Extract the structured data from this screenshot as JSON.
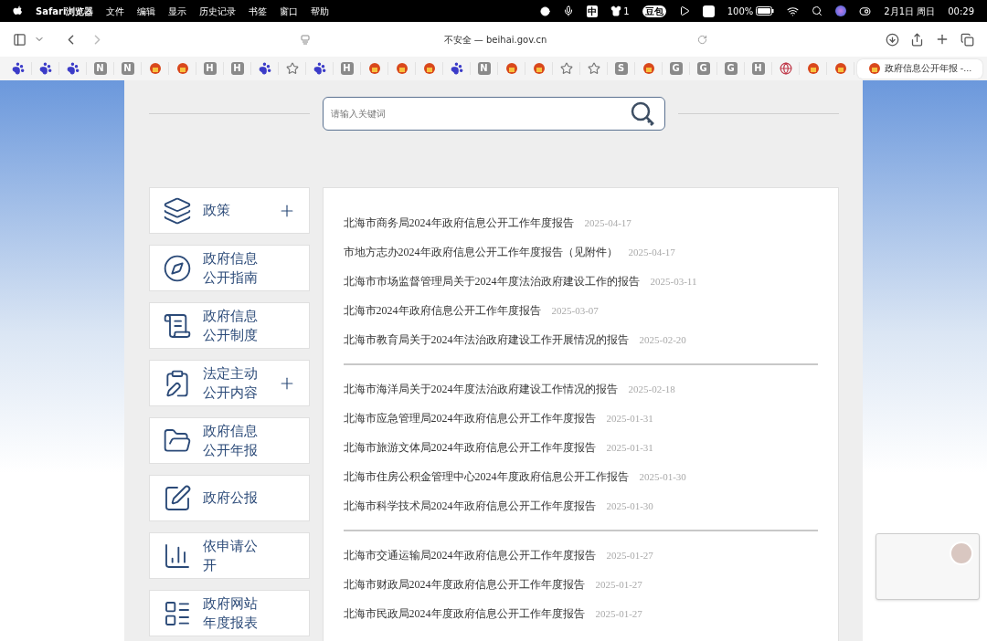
{
  "menu_bar": {
    "app_name": "Safari浏览器",
    "menus": [
      "文件",
      "编辑",
      "显示",
      "历史记录",
      "书签",
      "窗口",
      "帮助"
    ],
    "status": {
      "input_method": "中",
      "shirt_count": "1",
      "doubao": "豆包",
      "battery": "100%",
      "date": "2月1日 周日",
      "time": "00:29"
    }
  },
  "toolbar": {
    "address": "不安全 — beihai.gov.cn"
  },
  "favorites": [
    {
      "kind": "paw"
    },
    {
      "kind": "paw"
    },
    {
      "kind": "paw"
    },
    {
      "kind": "letter",
      "text": "N"
    },
    {
      "kind": "letter",
      "text": "N"
    },
    {
      "kind": "emblem"
    },
    {
      "kind": "emblem"
    },
    {
      "kind": "letter",
      "text": "H"
    },
    {
      "kind": "letter",
      "text": "H"
    },
    {
      "kind": "paw"
    },
    {
      "kind": "star"
    },
    {
      "kind": "paw"
    },
    {
      "kind": "letter",
      "text": "H"
    },
    {
      "kind": "emblem"
    },
    {
      "kind": "emblem"
    },
    {
      "kind": "emblem"
    },
    {
      "kind": "paw"
    },
    {
      "kind": "letter",
      "text": "N"
    },
    {
      "kind": "emblem"
    },
    {
      "kind": "emblem"
    },
    {
      "kind": "star"
    },
    {
      "kind": "star"
    },
    {
      "kind": "letter",
      "text": "S"
    },
    {
      "kind": "emblem"
    },
    {
      "kind": "letter",
      "text": "G"
    },
    {
      "kind": "letter",
      "text": "G"
    },
    {
      "kind": "letter",
      "text": "G"
    },
    {
      "kind": "letter",
      "text": "H"
    },
    {
      "kind": "globe"
    },
    {
      "kind": "emblem"
    },
    {
      "kind": "emblem"
    }
  ],
  "tab": {
    "title": "政府信息公开年报 -..."
  },
  "search": {
    "placeholder": "请输入关键词"
  },
  "sidebar": {
    "items": [
      {
        "kind": "layers",
        "label": "政策",
        "expandable": true
      },
      {
        "kind": "compass",
        "label": "政府信息公开指南",
        "expandable": false
      },
      {
        "kind": "list",
        "label": "政府信息公开制度",
        "expandable": false
      },
      {
        "kind": "clipboard",
        "label": "法定主动公开内容",
        "expandable": true
      },
      {
        "kind": "folder",
        "label": "政府信息公开年报",
        "expandable": false
      },
      {
        "kind": "pen",
        "label": "政府公报",
        "expandable": false
      },
      {
        "kind": "chart",
        "label": "依申请公开",
        "expandable": false
      },
      {
        "kind": "table",
        "label": "政府网站年度报表",
        "expandable": false
      }
    ]
  },
  "news_groups": [
    {
      "items": [
        {
          "title": "北海市商务局2024年政府信息公开工作年度报告",
          "date": "2025-04-17"
        },
        {
          "title": "市地方志办2024年政府信息公开工作年度报告（见附件）",
          "date": "2025-04-17"
        },
        {
          "title": "北海市市场监督管理局关于2024年度法治政府建设工作的报告",
          "date": "2025-03-11"
        },
        {
          "title": "北海市2024年政府信息公开工作年度报告",
          "date": "2025-03-07"
        },
        {
          "title": "北海市教育局关于2024年法治政府建设工作开展情况的报告",
          "date": "2025-02-20"
        }
      ]
    },
    {
      "items": [
        {
          "title": "北海市海洋局关于2024年度法治政府建设工作情况的报告",
          "date": "2025-02-18"
        },
        {
          "title": "北海市应急管理局2024年政府信息公开工作年度报告",
          "date": "2025-01-31"
        },
        {
          "title": "北海市旅游文体局2024年政府信息公开工作年度报告",
          "date": "2025-01-31"
        },
        {
          "title": "北海市住房公积金管理中心2024年度政府信息公开工作报告",
          "date": "2025-01-30"
        },
        {
          "title": "北海市科学技术局2024年政府信息公开工作年度报告",
          "date": "2025-01-30"
        }
      ]
    },
    {
      "items": [
        {
          "title": "北海市交通运输局2024年政府信息公开工作年度报告",
          "date": "2025-01-27"
        },
        {
          "title": "北海市财政局2024年度政府信息公开工作年度报告",
          "date": "2025-01-27"
        },
        {
          "title": "北海市民政局2024年度政府信息公开工作年度报告",
          "date": "2025-01-27"
        }
      ]
    }
  ]
}
